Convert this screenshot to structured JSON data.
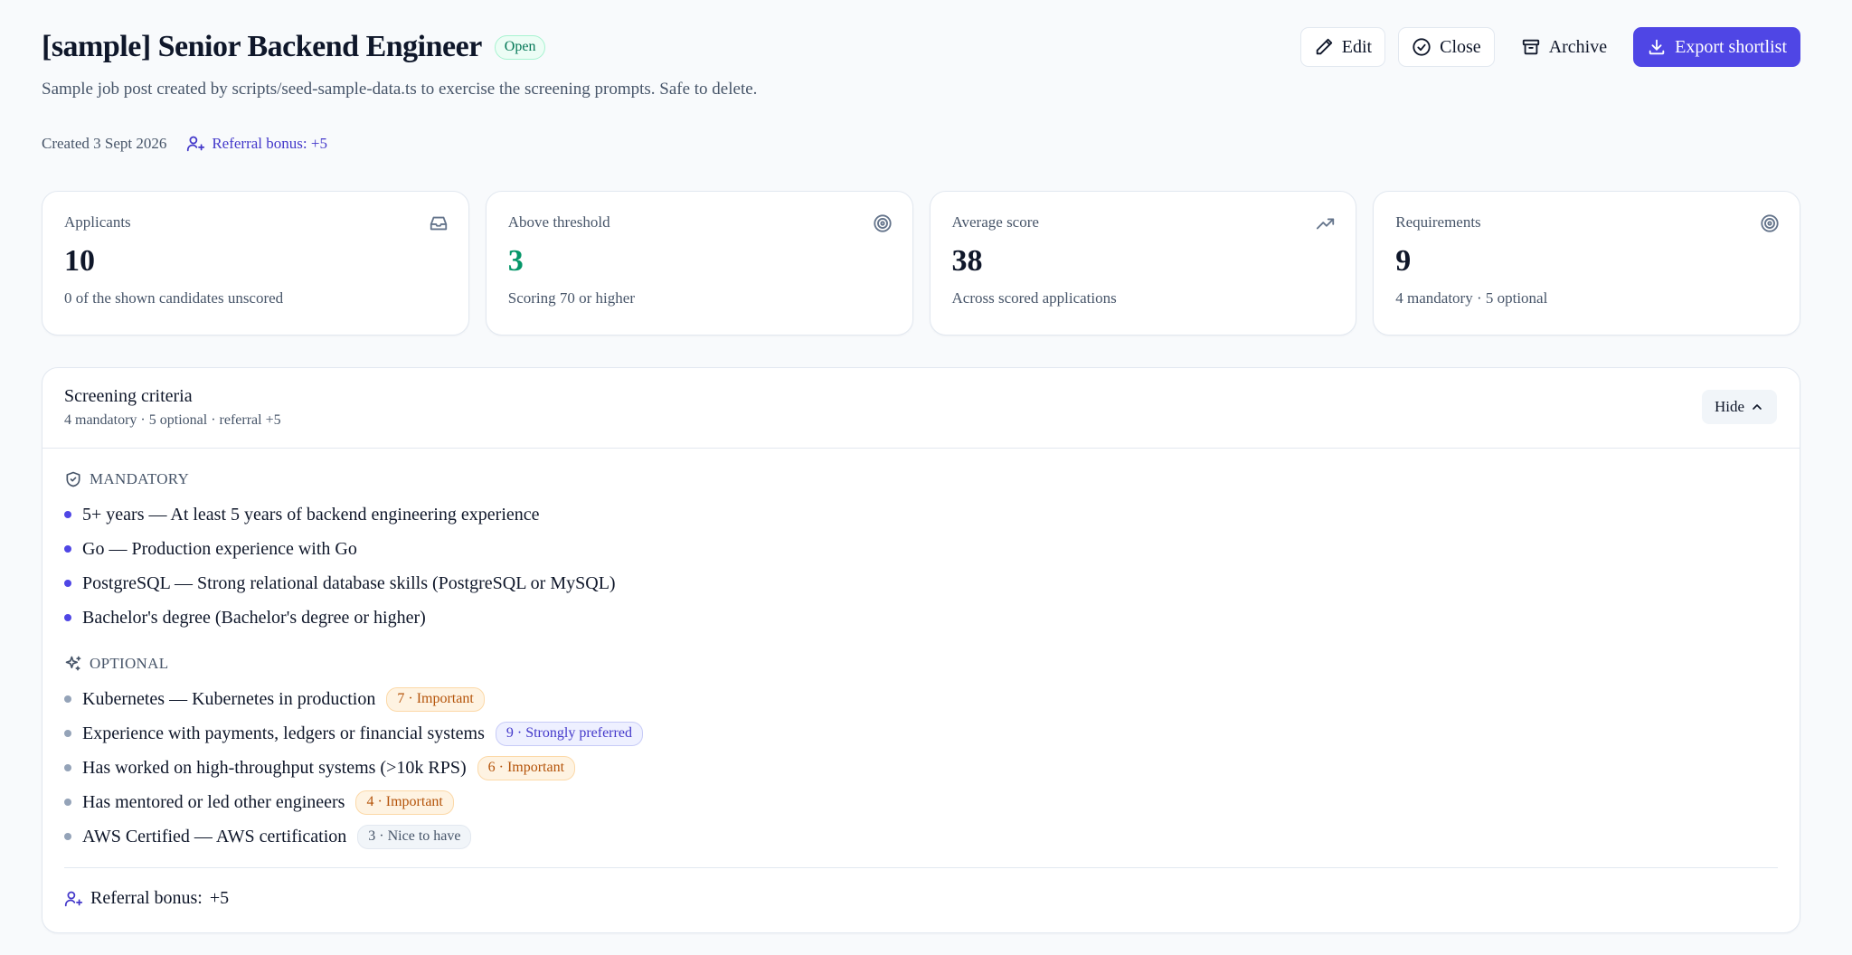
{
  "job": {
    "title": "[sample] Senior Backend Engineer",
    "status": "Open",
    "description": "Sample job post created by scripts/seed-sample-data.ts to exercise the screening prompts. Safe to delete.",
    "created": "Created 3 Sept 2026",
    "referral_bonus": "Referral bonus: +5"
  },
  "actions": {
    "edit": "Edit",
    "close": "Close",
    "archive": "Archive",
    "export": "Export shortlist"
  },
  "stats": [
    {
      "label": "Applicants",
      "value": "10",
      "note": "0 of the shown candidates unscored",
      "icon": "inbox-icon"
    },
    {
      "label": "Above threshold",
      "value": "3",
      "note": "Scoring 70 or higher",
      "icon": "target-icon"
    },
    {
      "label": "Average score",
      "value": "38",
      "note": "Across scored applications",
      "icon": "trending-up-icon"
    },
    {
      "label": "Requirements",
      "value": "9",
      "note": "4 mandatory · 5 optional",
      "icon": "target-icon"
    }
  ],
  "criteria": {
    "title": "Screening criteria",
    "subtitle": "4 mandatory · 5 optional · referral +5",
    "hide_label": "Hide",
    "mandatory_heading": "MANDATORY",
    "mandatory": [
      "5+ years — At least 5 years of backend engineering experience",
      "Go — Production experience with Go",
      "PostgreSQL — Strong relational database skills (PostgreSQL or MySQL)",
      "Bachelor's degree (Bachelor's degree or higher)"
    ],
    "optional_heading": "OPTIONAL",
    "optional": [
      {
        "text": "Kubernetes — Kubernetes in production",
        "weight": "7 · Important"
      },
      {
        "text": "Experience with payments, ledgers or financial systems",
        "weight": "9 · Strongly preferred"
      },
      {
        "text": "Has worked on high-throughput systems (>10k RPS)",
        "weight": "6 · Important"
      },
      {
        "text": "Has mentored or led other engineers",
        "weight": "4 · Important"
      },
      {
        "text": "AWS Certified — AWS certification",
        "weight": "3 · Nice to have"
      }
    ],
    "referral_label": "Referral bonus:",
    "referral_value": "+5"
  },
  "colors": {
    "accent": "#4f46e5",
    "success": "#059669",
    "important": "#b45309",
    "strong": "#4338ca",
    "nice": "#475569"
  }
}
